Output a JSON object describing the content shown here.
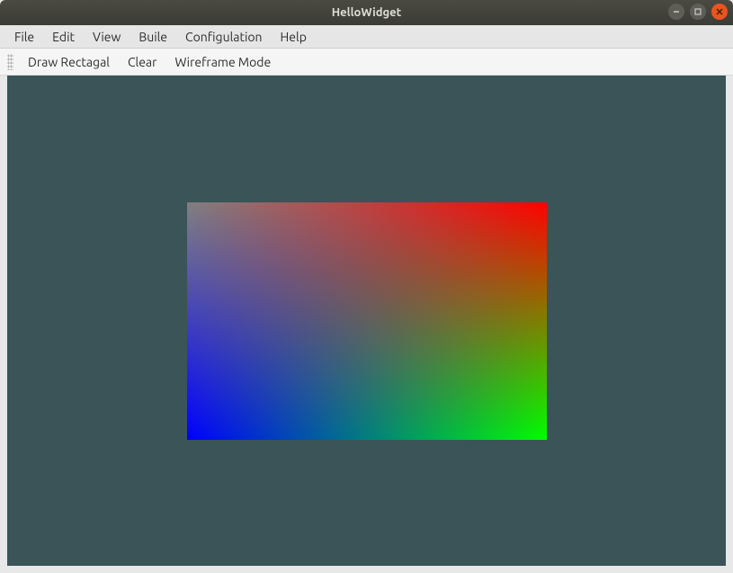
{
  "window": {
    "title": "HelloWidget"
  },
  "menubar": {
    "items": [
      "File",
      "Edit",
      "View",
      "Buile",
      "Configulation",
      "Help"
    ]
  },
  "toolbar": {
    "actions": [
      "Draw Rectagal",
      "Clear",
      "Wireframe Mode"
    ]
  },
  "canvas": {
    "background": "#3a5458",
    "rectangle": {
      "corners": {
        "top_left_color": "gray",
        "top_right_color": "red",
        "bottom_left_color": "blue",
        "bottom_right_color": "green"
      }
    }
  }
}
